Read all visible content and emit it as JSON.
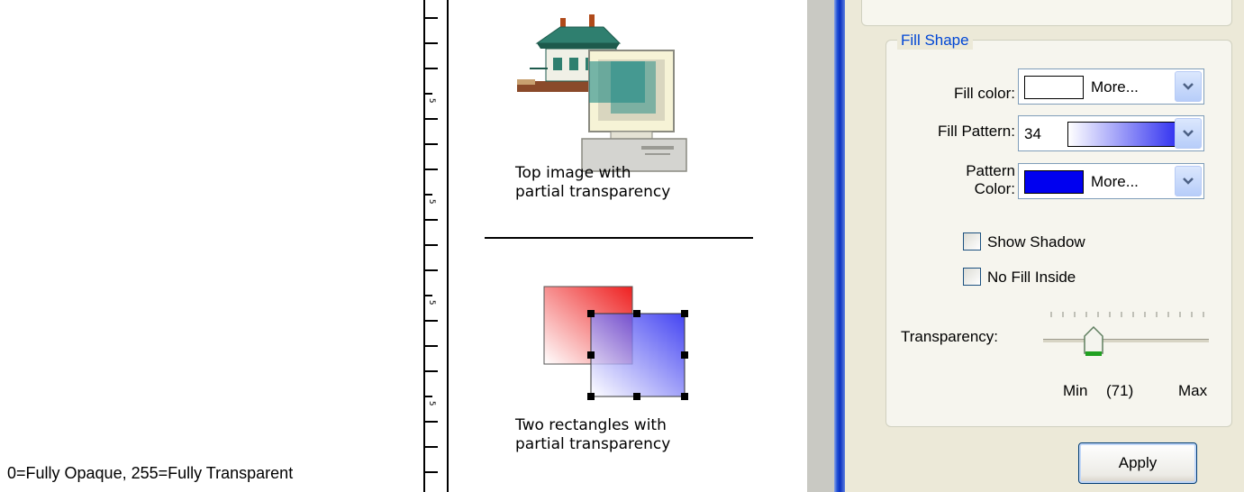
{
  "left_caption": "0=Fully Opaque, 255=Fully Transparent",
  "canvas": {
    "caption1_line1": "Top image with",
    "caption1_line2": "partial transparency",
    "caption2_line1": "Two rectangles with",
    "caption2_line2": "partial transparency"
  },
  "panel": {
    "group_title": "Fill Shape",
    "fill_color_label": "Fill color:",
    "fill_color_value": "More...",
    "fill_color_swatch": "#ffffff",
    "fill_pattern_label": "Fill Pattern:",
    "fill_pattern_number": "34",
    "pattern_color_label_line1": "Pattern",
    "pattern_color_label_line2": "Color:",
    "pattern_color_value": "More...",
    "pattern_color_swatch": "#0000f0",
    "show_shadow_label": "Show Shadow",
    "show_shadow_checked": false,
    "no_fill_inside_label": "No Fill Inside",
    "no_fill_inside_checked": false,
    "transparency_label": "Transparency:",
    "slider_min_label": "Min",
    "slider_value_label": "(71)",
    "slider_max_label": "Max",
    "slider_value": 71,
    "apply_label": "Apply"
  },
  "colors": {
    "accent_blue": "#0046d5",
    "rect_red": "#ee2020",
    "rect_blue": "#1010ee"
  }
}
